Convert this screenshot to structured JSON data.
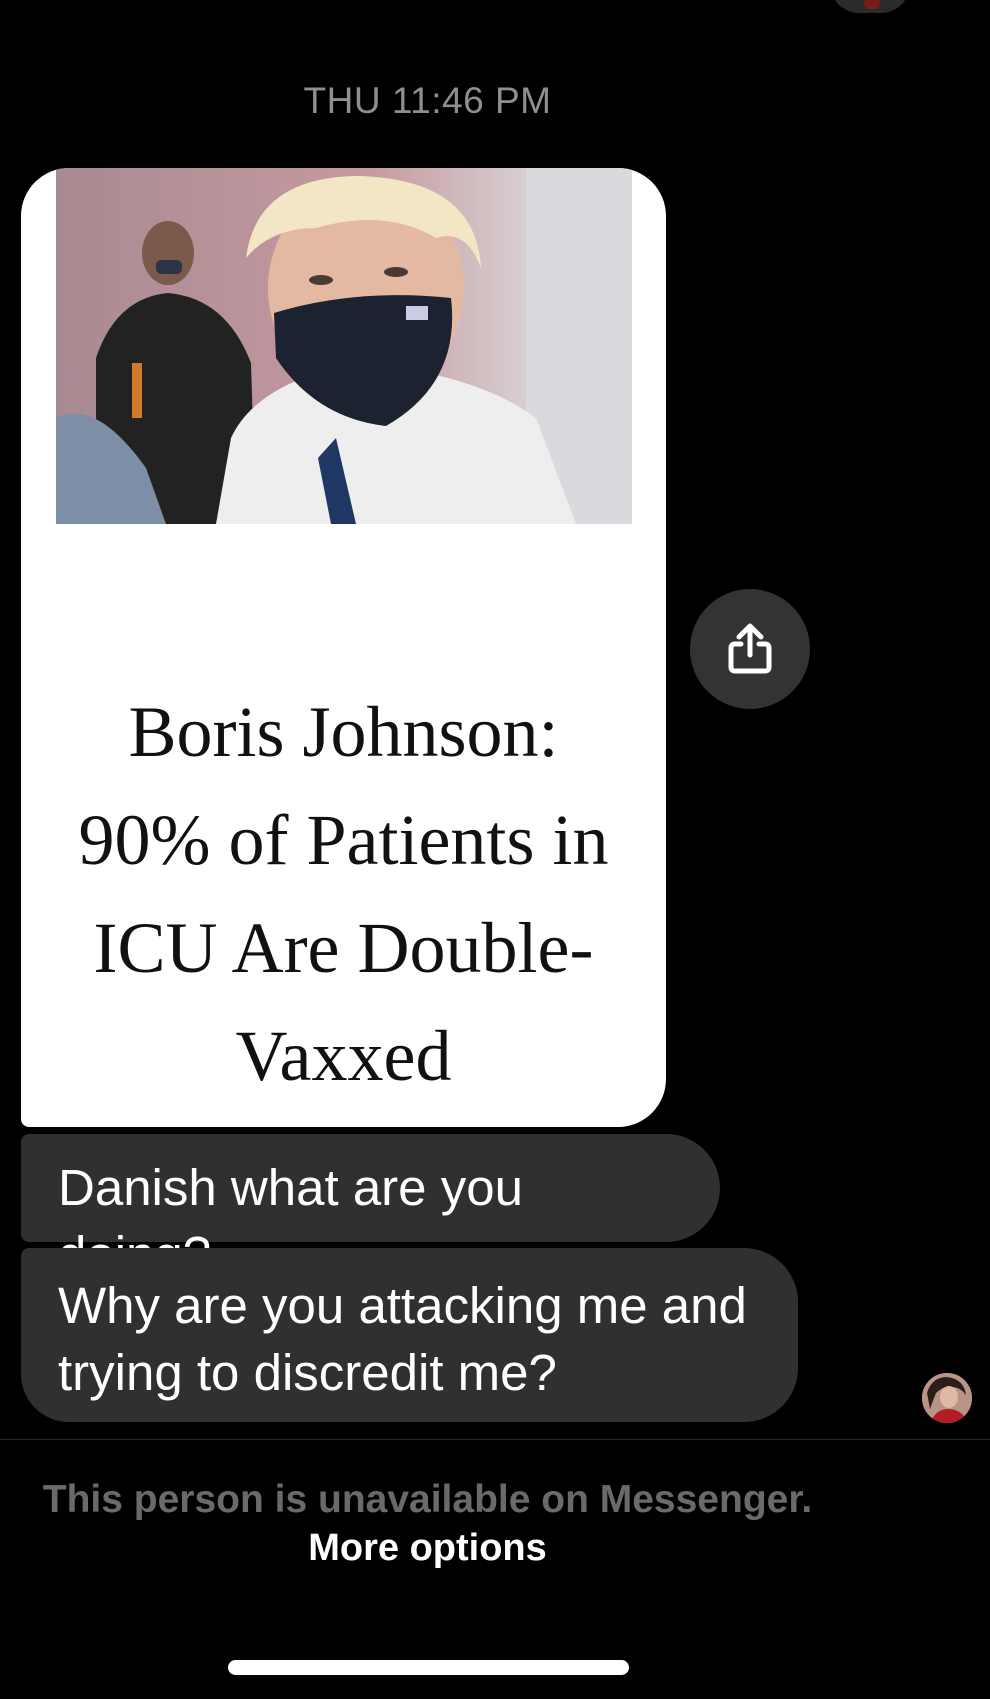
{
  "thread": {
    "timestamp": "THU 11:46 PM"
  },
  "shared_post": {
    "headline_lines": [
      "Boris Johnson:",
      "90% of Patients in",
      "ICU Are Double-",
      "Vaxxed"
    ],
    "share_icon": "share-icon"
  },
  "messages": [
    {
      "text": "Danish what are you doing?"
    },
    {
      "text": "Why are you attacking me and trying to discredit me?"
    }
  ],
  "footer": {
    "notice": "This person is unavailable on Messenger.",
    "more_options": "More options"
  },
  "colors": {
    "background": "#000000",
    "bubble": "#303033",
    "share_button": "#333336",
    "muted_text": "#6a6a6e"
  }
}
